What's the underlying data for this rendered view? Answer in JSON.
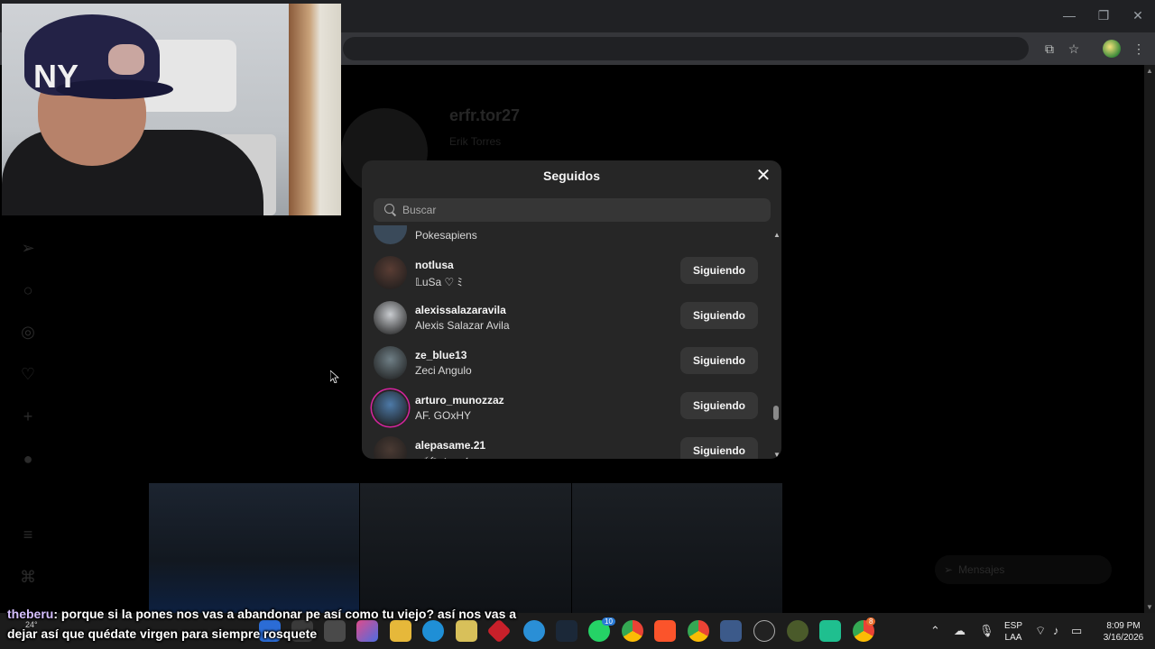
{
  "window": {
    "minimize_icon": "minimize-icon",
    "restore_icon": "restore-icon",
    "close_icon": "close-icon"
  },
  "toolbar": {
    "icons": [
      "install-app-icon",
      "bookmark-star-icon",
      "extension-avatar-icon",
      "more-menu-icon"
    ]
  },
  "profile": {
    "username": "erfr.tor27",
    "full_name": "Erik Torres"
  },
  "modal": {
    "title": "Seguidos",
    "search_placeholder": "Buscar",
    "partial_top_name": "Pokesapiens",
    "following": [
      {
        "username": "notlusa",
        "full_name": "𝕃uSa ♡ ﾐ",
        "button": "Siguiendo",
        "story": false,
        "avatar_color": "#5a3d34"
      },
      {
        "username": "alexissalazaravila",
        "full_name": "Alexis Salazar Avila",
        "button": "Siguiendo",
        "story": false,
        "avatar_color": "#c9ccd0"
      },
      {
        "username": "ze_blue13",
        "full_name": "Zeci Angulo",
        "button": "Siguiendo",
        "story": false,
        "avatar_color": "#6f7f86"
      },
      {
        "username": "arturo_munozzaz",
        "full_name": "AF. GOxHY",
        "button": "Siguiendo",
        "story": true,
        "avatar_color": "#4d7aa8"
      },
      {
        "username": "alepasame.21",
        "full_name": "𝒜𝓁𝑒𝒿𝒶𝓃𝒹𝓇𝒶",
        "button": "Siguiendo",
        "story": false,
        "avatar_color": "#4a3a33"
      }
    ]
  },
  "sidebar_icons": [
    "send-icon",
    "search-icon",
    "explore-icon",
    "heart-icon",
    "create-icon",
    "profile-icon",
    "menu-icon",
    "threads-icon"
  ],
  "messages_pill": {
    "label": "Mensajes"
  },
  "chat": {
    "user": "theberu",
    "message": ": porque si la pones nos vas a abandonar pe así como tu viejo? así nos vas a dejar así que quédate virgen para siempre rosquete"
  },
  "taskbar": {
    "weather": "24°",
    "language": "ESP",
    "layout": "LAA",
    "time": "8:09 PM",
    "date": "3/16/2026",
    "whatsapp_badge": "10",
    "chrome_badge": "8"
  },
  "colors": {
    "modal_bg": "#262626",
    "button_bg": "#363636",
    "story_ring": "#d6249f"
  }
}
